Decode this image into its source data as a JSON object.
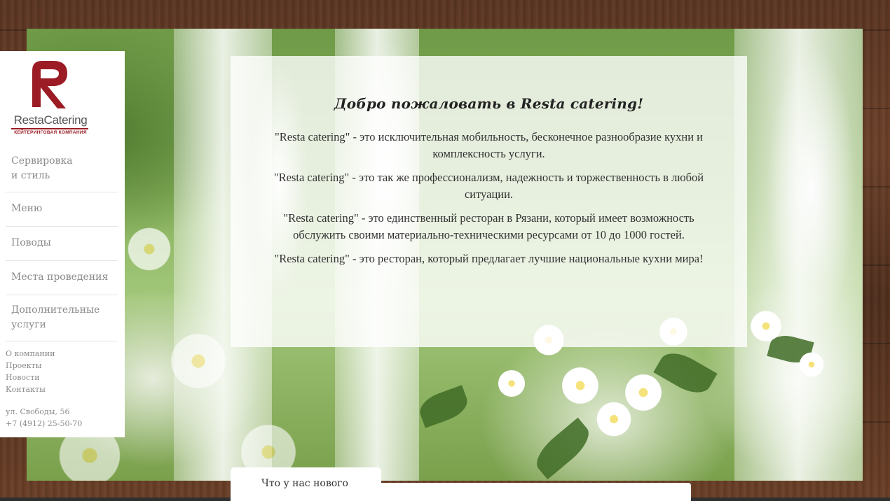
{
  "brand": {
    "name": "RestaCatering",
    "tagline": "КЕЙТЕРИНГОВАЯ КОМПАНИЯ",
    "color": "#9b1c24"
  },
  "nav": {
    "items": [
      {
        "label_line1": "Сервировка",
        "label_line2": "и стиль"
      },
      {
        "label": "Меню"
      },
      {
        "label": "Поводы"
      },
      {
        "label": "Места проведения"
      },
      {
        "label_line1": "Дополнительные",
        "label_line2": "услуги"
      }
    ]
  },
  "secondary_nav": {
    "items": [
      "О компании",
      "Проекты",
      "Новости",
      "Контакты"
    ]
  },
  "contact": {
    "address": "ул. Свободы, 56",
    "phone": "+7 (4912) 25-50-70"
  },
  "welcome": {
    "title": "Добро пожаловать в Resta catering!",
    "paragraphs": [
      "\"Resta catering\" - это исключительная мобильность, бесконечное разнообразие кухни и комплексность услуги.",
      "\"Resta catering\" - это так же профессионализм, надежность и торжественность в любой ситуации.",
      "\"Resta catering\" - это единственный ресторан в Рязани, который имеет возможность обслужить своими материально-техническими ресурсами от 10 до 1000 гостей.",
      "\"Resta catering\" - это ресторан, который предлагает лучшие национальные кухни мира!"
    ]
  },
  "news": {
    "tab_label": "Что у нас нового"
  },
  "icons": {
    "logo": "resta-logo-icon"
  }
}
